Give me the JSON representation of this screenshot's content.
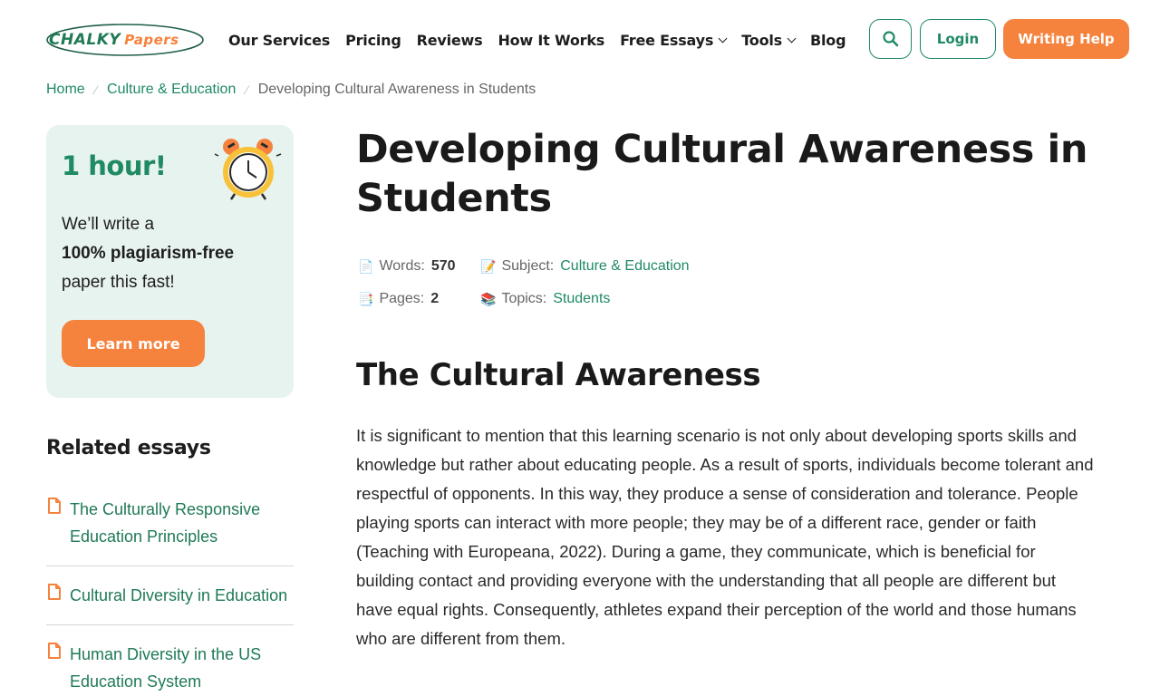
{
  "header": {
    "logo": {
      "part1": "CHALKY",
      "part2": "Papers"
    },
    "nav": [
      {
        "label": "Our Services",
        "has_dropdown": false
      },
      {
        "label": "Pricing",
        "has_dropdown": false
      },
      {
        "label": "Reviews",
        "has_dropdown": false
      },
      {
        "label": "How It Works",
        "has_dropdown": false
      },
      {
        "label": "Free Essays",
        "has_dropdown": true
      },
      {
        "label": "Tools",
        "has_dropdown": true
      },
      {
        "label": "Blog",
        "has_dropdown": false
      }
    ],
    "search_icon": "search-icon",
    "login_label": "Login",
    "help_label": "Writing Help"
  },
  "breadcrumb": {
    "items": [
      "Home",
      "Culture & Education"
    ],
    "current": "Developing Cultural Awareness in Students"
  },
  "promo": {
    "title": "1 hour!",
    "line1": "We’ll write a",
    "line2_bold": "100% plagiarism-free",
    "line3": "paper this fast!",
    "button": "Learn more",
    "icon": "alarm-clock-icon"
  },
  "related": {
    "title": "Related essays",
    "items": [
      "The Culturally Responsive Education Principles",
      "Cultural Diversity in Education",
      "Human Diversity in the US Education System"
    ]
  },
  "article": {
    "title": "Developing Cultural Awareness in Students",
    "meta": {
      "words_label": "Words:",
      "words_value": "570",
      "pages_label": "Pages:",
      "pages_value": "2",
      "subject_label": "Subject:",
      "subject_value": "Culture & Education",
      "topics_label": "Topics:",
      "topics_value": "Students"
    },
    "section_title": "The Cultural Awareness",
    "paragraph": "It is significant to mention that this learning scenario is not only about developing sports skills and knowledge but rather about educating people. As a result of sports, individuals become tolerant and respectful of opponents. In this way, they produce a sense of consideration and tolerance. People playing sports can interact with more people; they may be of a different race, gender or faith (Teaching with Europeana, 2022). During a game, they communicate, which is beneficial for building contact and providing everyone with the understanding that all people are different but have equal rights. Consequently, athletes expand their perception of the world and those humans who are different from them."
  },
  "colors": {
    "brand_green": "#1f8a63",
    "brand_orange": "#f5823d",
    "promo_bg": "#e7f3ee"
  }
}
